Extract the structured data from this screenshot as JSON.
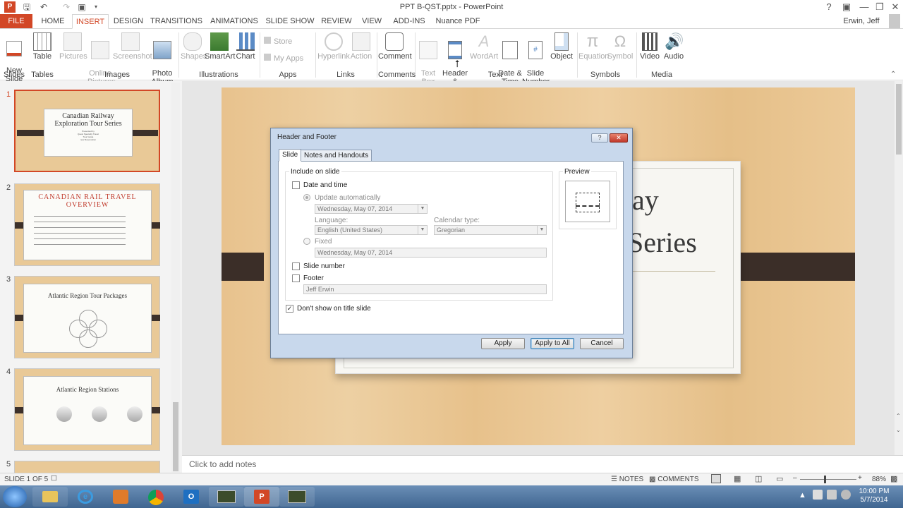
{
  "window": {
    "title": "PPT B-QST.pptx - PowerPoint",
    "user": "Erwin, Jeff"
  },
  "tabs": [
    "FILE",
    "HOME",
    "INSERT",
    "DESIGN",
    "TRANSITIONS",
    "ANIMATIONS",
    "SLIDE SHOW",
    "REVIEW",
    "VIEW",
    "ADD-INS",
    "Nuance PDF"
  ],
  "ribbon": {
    "new_slide": "New\nSlide",
    "table": "Table",
    "pictures": "Pictures",
    "online_pictures": "Online\nPictures",
    "screenshot": "Screenshot",
    "photo_album": "Photo\nAlbum",
    "shapes": "Shapes",
    "smartart": "SmartArt",
    "chart": "Chart",
    "store": "Store",
    "my_apps": "My Apps",
    "hyperlink": "Hyperlink",
    "action": "Action",
    "comment": "Comment",
    "text_box": "Text\nBox",
    "header_footer": "Header\n& Footer",
    "wordart": "WordArt",
    "date_time": "Date &\nTime",
    "slide_number": "Slide\nNumber",
    "object": "Object",
    "equation": "Equation",
    "symbol": "Symbol",
    "video": "Video",
    "audio": "Audio",
    "groups": {
      "slides": "Slides",
      "tables": "Tables",
      "images": "Images",
      "illustrations": "Illustrations",
      "apps": "Apps",
      "links": "Links",
      "comments": "Comments",
      "text": "Text",
      "symbols": "Symbols",
      "media": "Media"
    }
  },
  "thumbnails": [
    {
      "num": "1",
      "title": "Canadian Railway\nExploration Tour Series",
      "sub": "Presented by\nQuest Specialty Travel\nTour Guide\nnow Reservation"
    },
    {
      "num": "2",
      "title": "CANADIAN RAIL TRAVEL\nOVERVIEW"
    },
    {
      "num": "3",
      "title": "Atlantic Region Tour Packages"
    },
    {
      "num": "4",
      "title": "Atlantic Region Stations"
    },
    {
      "num": "5",
      "title": ""
    }
  ],
  "slide": {
    "title_line1": "ay",
    "title_line2": "Series"
  },
  "notes_placeholder": "Click to add notes",
  "status": {
    "slide": "SLIDE 1 OF 5",
    "notes": "NOTES",
    "comments": "COMMENTS",
    "zoom": "88%"
  },
  "clock": {
    "time": "10:00 PM",
    "date": "5/7/2014"
  },
  "dialog": {
    "title": "Header and Footer",
    "tabs": [
      "Slide",
      "Notes and Handouts"
    ],
    "include_label": "Include on slide",
    "preview_label": "Preview",
    "date_time": "Date and time",
    "update_auto": "Update automatically",
    "date_value": "Wednesday, May 07, 2014",
    "language_label": "Language:",
    "language_value": "English (United States)",
    "calendar_label": "Calendar type:",
    "calendar_value": "Gregorian",
    "fixed": "Fixed",
    "fixed_value": "Wednesday, May 07, 2014",
    "slide_number": "Slide number",
    "footer": "Footer",
    "footer_value": "Jeff Erwin",
    "dont_show": "Don't show on title slide",
    "apply": "Apply",
    "apply_all": "Apply to All",
    "cancel": "Cancel"
  }
}
